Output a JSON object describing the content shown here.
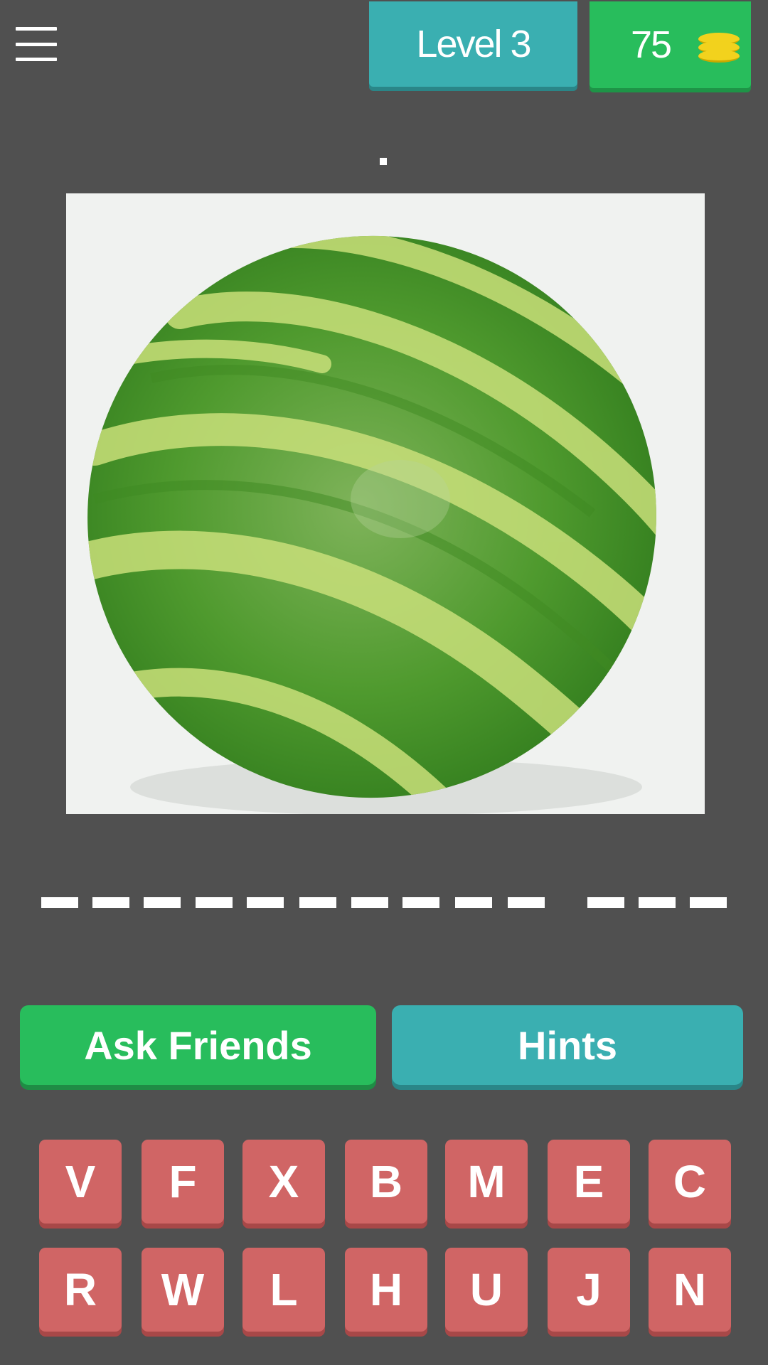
{
  "header": {
    "menu_icon": "hamburger-menu-icon",
    "level_label": "Level 3",
    "coins": "75",
    "coin_icon": "coin-stack-icon"
  },
  "puzzle": {
    "hint_text": ".",
    "image_subject": "watermelon",
    "answer_word_lengths": [
      10,
      3
    ]
  },
  "actions": {
    "ask_friends_label": "Ask Friends",
    "hints_label": "Hints"
  },
  "keyboard": {
    "rows": [
      [
        "V",
        "F",
        "X",
        "B",
        "M",
        "E",
        "C"
      ],
      [
        "R",
        "W",
        "L",
        "H",
        "U",
        "J",
        "N"
      ]
    ]
  },
  "colors": {
    "background": "#505050",
    "teal": "#3aafb1",
    "green": "#28bd5c",
    "key_red": "#d06565",
    "coin_yellow": "#f2d21d"
  }
}
